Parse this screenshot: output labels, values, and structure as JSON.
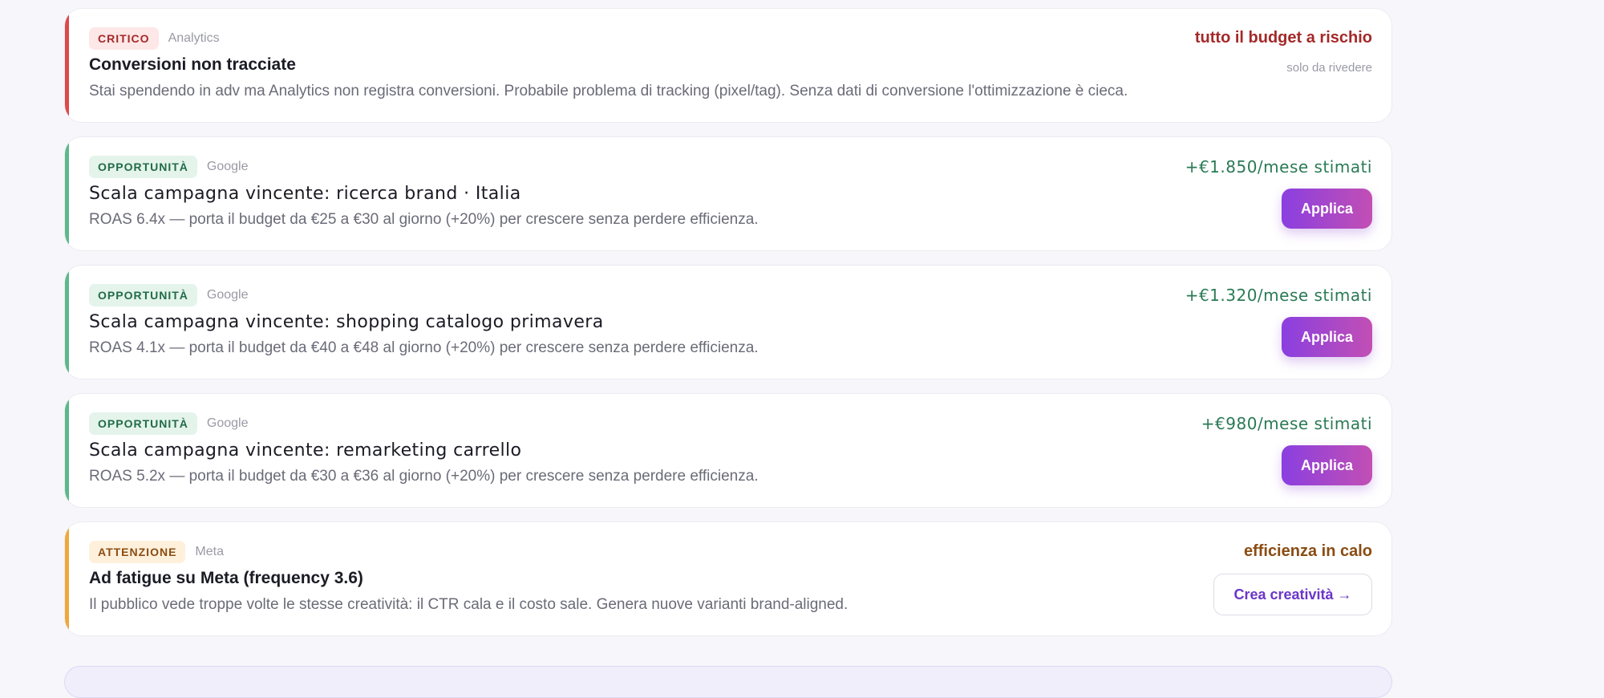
{
  "cards": [
    {
      "badge": "CRITICO",
      "source": "Analytics",
      "title": "Conversioni non tracciate",
      "description": "Stai spendendo in adv ma Analytics non registra conversioni. Probabile problema di tracking (pixel/tag). Senza dati di conversione l'ottimizzazione è cieca.",
      "impact": "tutto il budget a rischio",
      "note": "solo da rivedere"
    },
    {
      "badge": "OPPORTUNITÀ",
      "source": "Google",
      "title": "Scala campagna vincente: ricerca brand · Italia",
      "description": "ROAS 6.4x — porta il budget da €25 a €30 al giorno (+20%) per crescere senza perdere efficienza.",
      "impact": "+€1.850/mese stimati",
      "action": "Applica"
    },
    {
      "badge": "OPPORTUNITÀ",
      "source": "Google",
      "title": "Scala campagna vincente: shopping catalogo primavera",
      "description": "ROAS 4.1x — porta il budget da €40 a €48 al giorno (+20%) per crescere senza perdere efficienza.",
      "impact": "+€1.320/mese stimati",
      "action": "Applica"
    },
    {
      "badge": "OPPORTUNITÀ",
      "source": "Google",
      "title": "Scala campagna vincente: remarketing carrello",
      "description": "ROAS 5.2x — porta il budget da €30 a €36 al giorno (+20%) per crescere senza perdere efficienza.",
      "impact": "+€980/mese stimati",
      "action": "Applica"
    },
    {
      "badge": "ATTENZIONE",
      "source": "Meta",
      "title": "Ad fatigue su Meta (frequency 3.6)",
      "description": "Il pubblico vede troppe volte le stesse creatività: il CTR cala e il costo sale. Genera nuove varianti brand-aligned.",
      "impact": "efficienza in calo",
      "action": "Crea creatività →"
    }
  ],
  "colors": {
    "critical": "#dc4a4a",
    "opportunity": "#5cb88a",
    "warning": "#eea83a",
    "accent_gradient_start": "#8a3fe0",
    "accent_gradient_end": "#c24fb4"
  }
}
